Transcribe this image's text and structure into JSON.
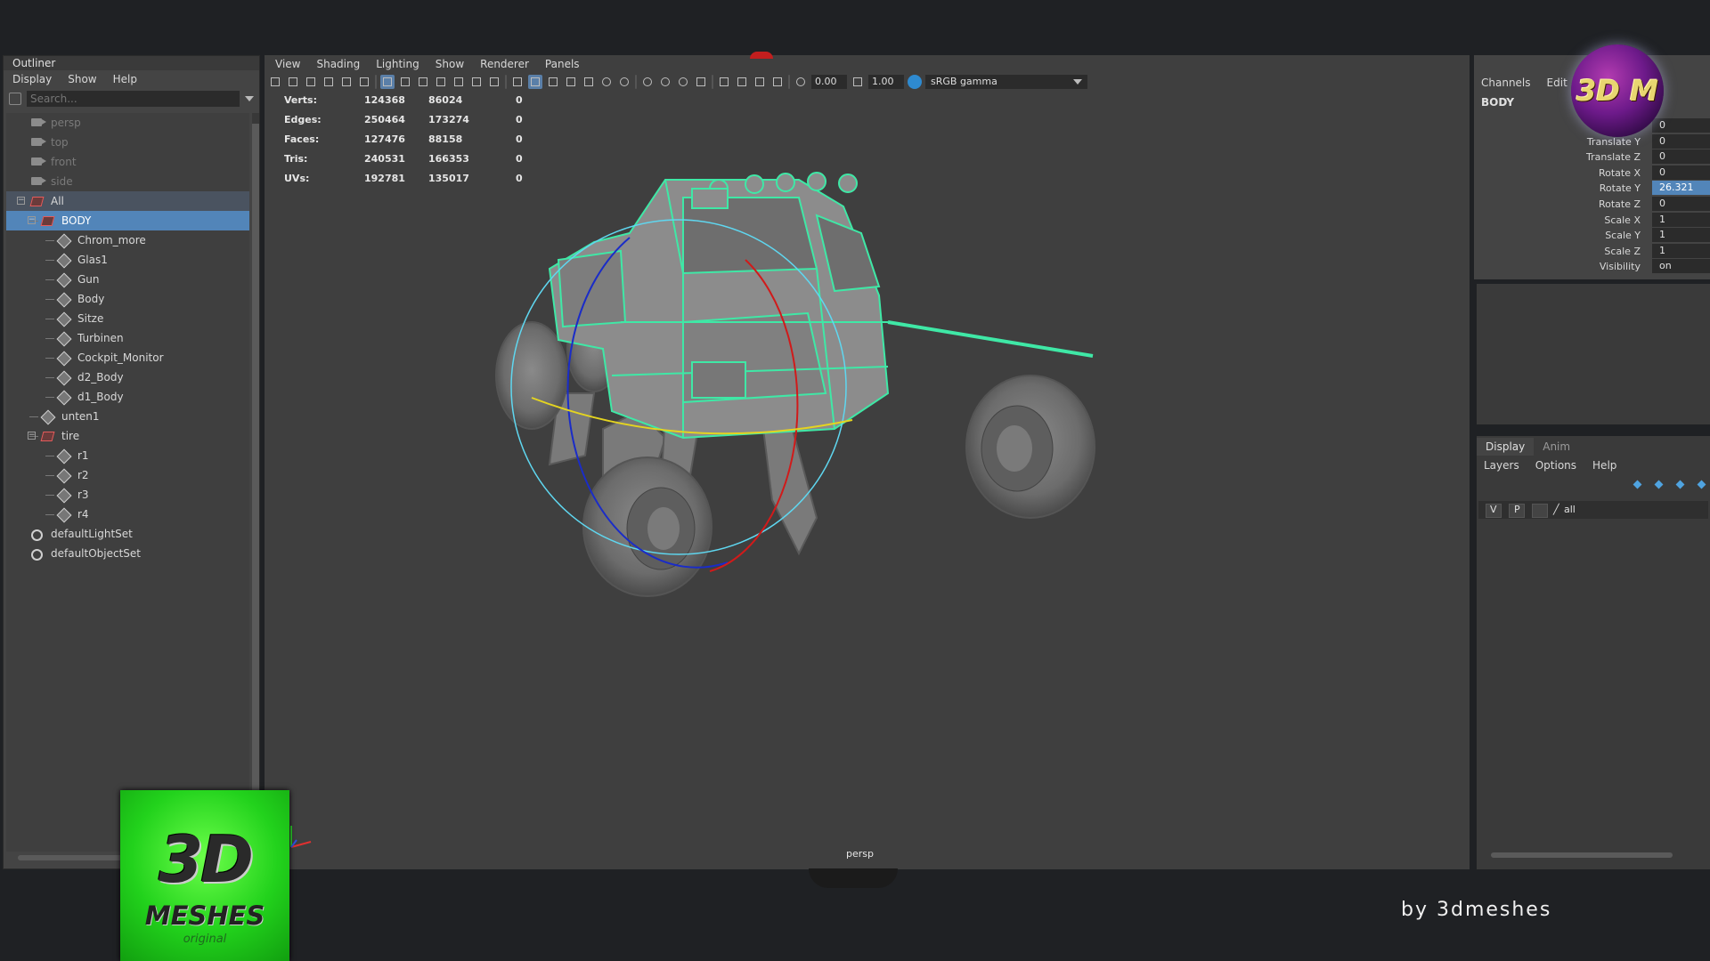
{
  "outliner": {
    "title": "Outliner",
    "menu": [
      "Display",
      "Show",
      "Help"
    ],
    "search_placeholder": "Search...",
    "items": [
      {
        "label": "persp",
        "type": "camera",
        "depth": 0
      },
      {
        "label": "top",
        "type": "camera",
        "depth": 0
      },
      {
        "label": "front",
        "type": "camera",
        "depth": 0
      },
      {
        "label": "side",
        "type": "camera",
        "depth": 0
      },
      {
        "label": "All",
        "type": "group",
        "depth": 0
      },
      {
        "label": "BODY",
        "type": "group",
        "depth": 1
      },
      {
        "label": "Chrom_more",
        "type": "mesh",
        "depth": 2
      },
      {
        "label": "Glas1",
        "type": "mesh",
        "depth": 2
      },
      {
        "label": "Gun",
        "type": "mesh",
        "depth": 2
      },
      {
        "label": "Body",
        "type": "mesh",
        "depth": 2
      },
      {
        "label": "Sitze",
        "type": "mesh",
        "depth": 2
      },
      {
        "label": "Turbinen",
        "type": "mesh",
        "depth": 2
      },
      {
        "label": "Cockpit_Monitor",
        "type": "mesh",
        "depth": 2
      },
      {
        "label": "d2_Body",
        "type": "mesh",
        "depth": 2
      },
      {
        "label": "d1_Body",
        "type": "mesh",
        "depth": 2
      },
      {
        "label": "unten1",
        "type": "mesh",
        "depth": 1
      },
      {
        "label": "tire",
        "type": "group",
        "depth": 1
      },
      {
        "label": "r1",
        "type": "mesh",
        "depth": 2
      },
      {
        "label": "r2",
        "type": "mesh",
        "depth": 2
      },
      {
        "label": "r3",
        "type": "mesh",
        "depth": 2
      },
      {
        "label": "r4",
        "type": "mesh",
        "depth": 2
      },
      {
        "label": "defaultLightSet",
        "type": "set",
        "depth": 0
      },
      {
        "label": "defaultObjectSet",
        "type": "set",
        "depth": 0
      }
    ]
  },
  "viewport": {
    "menu": [
      "View",
      "Shading",
      "Lighting",
      "Show",
      "Renderer",
      "Panels"
    ],
    "exposure": "0.00",
    "gamma": "1.00",
    "color_space": "sRGB gamma",
    "camera": "persp",
    "hud": [
      {
        "label": "Verts:",
        "a": "124368",
        "b": "86024",
        "c": "0"
      },
      {
        "label": "Edges:",
        "a": "250464",
        "b": "173274",
        "c": "0"
      },
      {
        "label": "Faces:",
        "a": "127476",
        "b": "88158",
        "c": "0"
      },
      {
        "label": "Tris:",
        "a": "240531",
        "b": "166353",
        "c": "0"
      },
      {
        "label": "UVs:",
        "a": "192781",
        "b": "135017",
        "c": "0"
      }
    ]
  },
  "channelbox": {
    "menu": [
      "Channels",
      "Edit"
    ],
    "object": "BODY",
    "channels": [
      {
        "label": "",
        "value": "0"
      },
      {
        "label": "Translate Y",
        "value": "0"
      },
      {
        "label": "Translate Z",
        "value": "0"
      },
      {
        "label": "Rotate X",
        "value": "0"
      },
      {
        "label": "Rotate Y",
        "value": "26.321",
        "highlight": true
      },
      {
        "label": "Rotate Z",
        "value": "0"
      },
      {
        "label": "Scale X",
        "value": "1"
      },
      {
        "label": "Scale Y",
        "value": "1"
      },
      {
        "label": "Scale Z",
        "value": "1"
      },
      {
        "label": "Visibility",
        "value": "on"
      }
    ]
  },
  "layers": {
    "tabs": [
      "Display",
      "Anim"
    ],
    "active_tab": "Display",
    "menu": [
      "Layers",
      "Options",
      "Help"
    ],
    "rows": [
      {
        "v": "V",
        "p": "P",
        "name": "all"
      }
    ]
  },
  "branding": {
    "badge_text": "3D M",
    "logo_big": "3D",
    "logo_mid": "MESHES",
    "logo_small": "original",
    "byline": "by 3dmeshes"
  },
  "colors": {
    "selection": "#5285b9",
    "wireframe": "#3fe8a6",
    "accent_green": "#22d21c",
    "badge_purple": "#6d1a8a"
  }
}
